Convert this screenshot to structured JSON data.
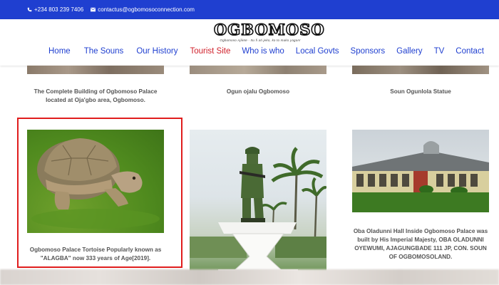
{
  "topbar": {
    "phone": "+234 803 239 7406",
    "email": "contactus@ogbomosoconnection.com",
    "phone_icon": "phone-icon",
    "email_icon": "envelope-icon",
    "bg": "#1f3fd0"
  },
  "logo": {
    "text": "OGBOMOSO",
    "tagline": "Ogbomoso Ajilete - Itu fi ati jeko, ko to muko yagan!"
  },
  "nav": {
    "items": [
      "Home",
      "The Souns",
      "Our History",
      "Tourist Site",
      "Who is who",
      "Local Govts",
      "Sponsors",
      "Gallery",
      "TV",
      "Contact"
    ],
    "active": "Tourist Site",
    "link_color": "#1f3fd0",
    "active_color": "#d01f2a"
  },
  "gallery": {
    "row1_captions": [
      "The Complete Building of Ogbomoso Palace located at Oja'gbo area, Ogbomoso.",
      "Ogun ojalu Ogbomoso",
      "Soun Ogunlola Statue"
    ],
    "row2_captions": [
      "Ogbomoso Palace Tortoise Popularly known as \"ALAGBA\" now 333 years of Age[2019].",
      "",
      "Oba Oladunni Hall Inside Ogbomoso Palace was built by His Imperial Majesty, OBA OLADUNNI OYEWUMI, AJAGUNGBADE 111 JP, CON. SOUN OF OGBOMOSOLAND."
    ],
    "highlight_color": "#e01d1d"
  }
}
